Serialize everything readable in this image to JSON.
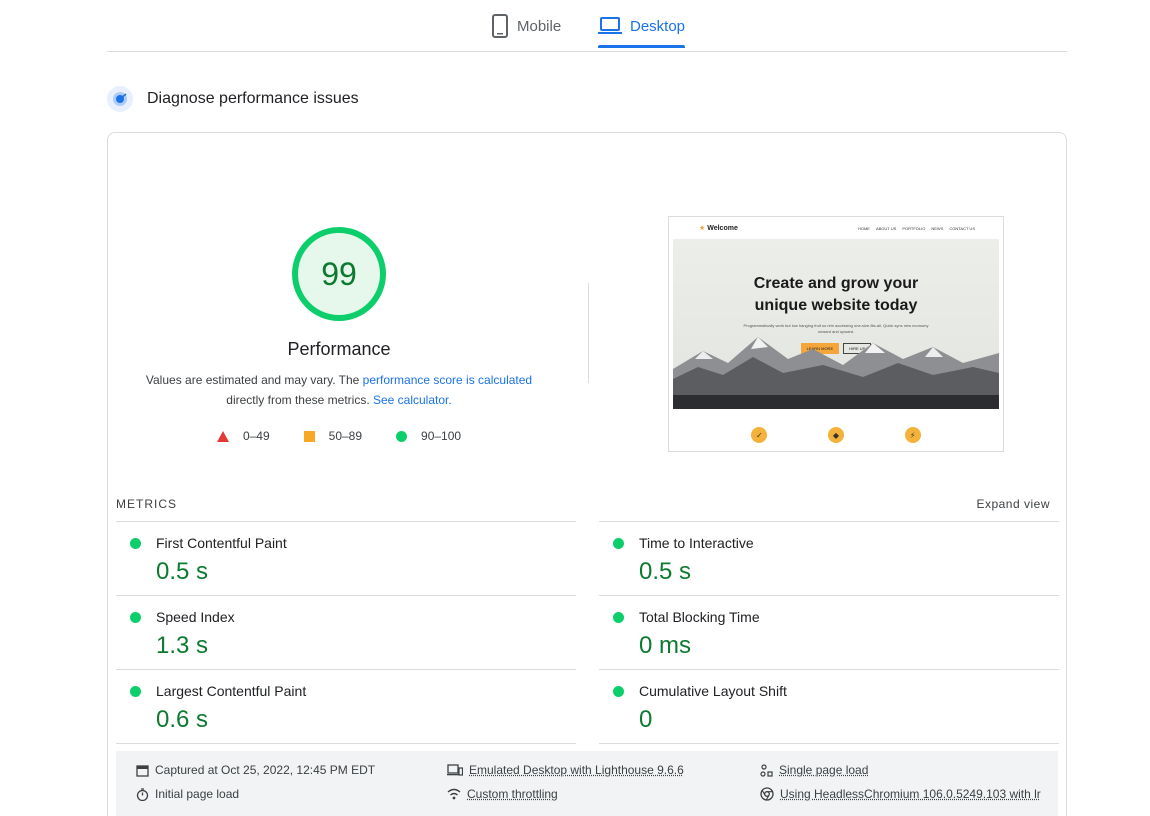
{
  "tabs": {
    "mobile_label": "Mobile",
    "desktop_label": "Desktop"
  },
  "diagnose": {
    "title": "Diagnose performance issues"
  },
  "performance": {
    "score": "99",
    "label": "Performance",
    "desc_prefix": "Values are estimated and may vary. The ",
    "desc_link1": "performance score is calculated",
    "desc_middle": " directly from these metrics. ",
    "desc_link2": "See calculator.",
    "legend": [
      {
        "range": "0–49",
        "color": "#e53935"
      },
      {
        "range": "50–89",
        "color": "#f9a825"
      },
      {
        "range": "90–100",
        "color": "#0cce6b"
      }
    ]
  },
  "preview": {
    "brand": "Welcome",
    "nav_links": [
      "HOME",
      "ABOUT US",
      "PORTFOLIO",
      "NEWS",
      "CONTACT US"
    ],
    "headline_1": "Create and grow your",
    "headline_2": "unique website today",
    "subtext": "Programmatically work but low hanging fruit so rein accessing one-size-fits-all. Quick sync new economy onward and upward.",
    "btn_primary": "LEARN MORE",
    "btn_secondary": "HIRE US"
  },
  "metrics": {
    "heading": "METRICS",
    "expand_label": "Expand view",
    "items": [
      {
        "name": "First Contentful Paint",
        "value": "0.5 s"
      },
      {
        "name": "Time to Interactive",
        "value": "0.5 s"
      },
      {
        "name": "Speed Index",
        "value": "1.3 s"
      },
      {
        "name": "Total Blocking Time",
        "value": "0 ms"
      },
      {
        "name": "Largest Contentful Paint",
        "value": "0.6 s"
      },
      {
        "name": "Cumulative Layout Shift",
        "value": "0"
      }
    ]
  },
  "footer": {
    "captured": "Captured at Oct 25, 2022, 12:45 PM EDT",
    "initial_load": "Initial page load",
    "emulated": "Emulated Desktop with Lighthouse 9.6.6",
    "throttling": "Custom throttling",
    "single_load": "Single page load",
    "browser": "Using HeadlessChromium 106.0.5249.103 with lr"
  },
  "colors": {
    "accent": "#1a73e8",
    "pass": "#0cce6b",
    "pass_text": "#0c7a2f"
  }
}
